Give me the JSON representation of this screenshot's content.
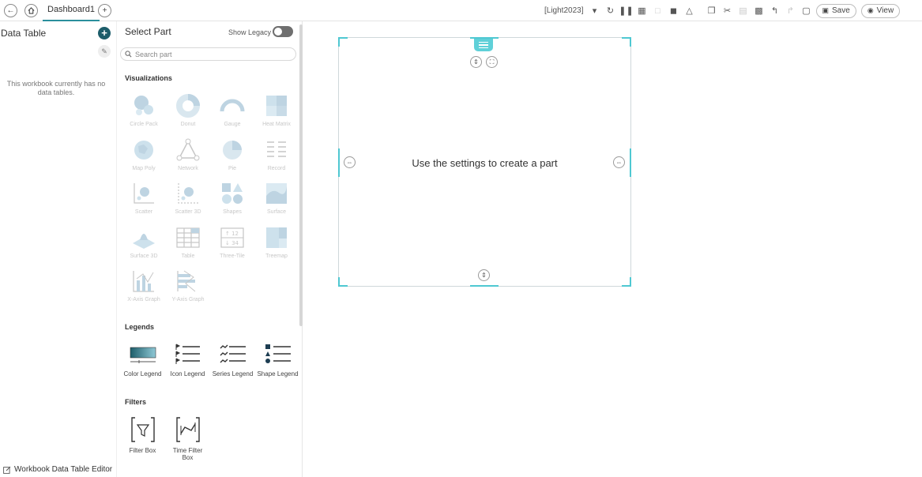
{
  "topbar": {
    "back_icon": "arrow-left-icon",
    "home_icon": "home-icon",
    "tab_label": "Dashboard1",
    "add_tab_icon": "plus-icon",
    "theme_label": "[Light2023]",
    "save_label": "Save",
    "view_label": "View"
  },
  "data_panel": {
    "title": "Data Table",
    "empty_message": "This workbook currently has no data tables.",
    "footer_label": "Workbook Data Table Editor"
  },
  "part_panel": {
    "title": "Select Part",
    "show_legacy_label": "Show Legacy",
    "search_placeholder": "Search part",
    "visualizations_heading": "Visualizations",
    "visualizations": [
      {
        "label": "Circle Pack",
        "icon": "circle-pack-icon"
      },
      {
        "label": "Donut",
        "icon": "donut-icon"
      },
      {
        "label": "Gauge",
        "icon": "gauge-icon"
      },
      {
        "label": "Heat Matrix",
        "icon": "heat-matrix-icon"
      },
      {
        "label": "Map Poly",
        "icon": "map-poly-icon"
      },
      {
        "label": "Network",
        "icon": "network-icon"
      },
      {
        "label": "Pie",
        "icon": "pie-icon"
      },
      {
        "label": "Record",
        "icon": "record-icon"
      },
      {
        "label": "Scatter",
        "icon": "scatter-icon"
      },
      {
        "label": "Scatter 3D",
        "icon": "scatter-3d-icon"
      },
      {
        "label": "Shapes",
        "icon": "shapes-icon"
      },
      {
        "label": "Surface",
        "icon": "surface-icon"
      },
      {
        "label": "Surface 3D",
        "icon": "surface-3d-icon"
      },
      {
        "label": "Table",
        "icon": "table-icon"
      },
      {
        "label": "Three-Tile",
        "icon": "three-tile-icon"
      },
      {
        "label": "Treemap",
        "icon": "treemap-icon"
      },
      {
        "label": "X-Axis Graph",
        "icon": "x-axis-graph-icon"
      },
      {
        "label": "Y-Axis Graph",
        "icon": "y-axis-graph-icon"
      }
    ],
    "legends_heading": "Legends",
    "legends": [
      {
        "label": "Color Legend",
        "icon": "color-legend-icon"
      },
      {
        "label": "Icon Legend",
        "icon": "icon-legend-icon"
      },
      {
        "label": "Series Legend",
        "icon": "series-legend-icon"
      },
      {
        "label": "Shape Legend",
        "icon": "shape-legend-icon"
      }
    ],
    "filters_heading": "Filters",
    "filters": [
      {
        "label": "Filter Box",
        "icon": "filter-box-icon"
      },
      {
        "label": "Time Filter Box",
        "icon": "time-filter-box-icon"
      }
    ]
  },
  "canvas": {
    "placeholder_message": "Use the settings to create a part"
  },
  "colors": {
    "accent": "#4fc8d2",
    "add_button": "#1d5d6a",
    "tab_underline": "#2a8f9c"
  }
}
